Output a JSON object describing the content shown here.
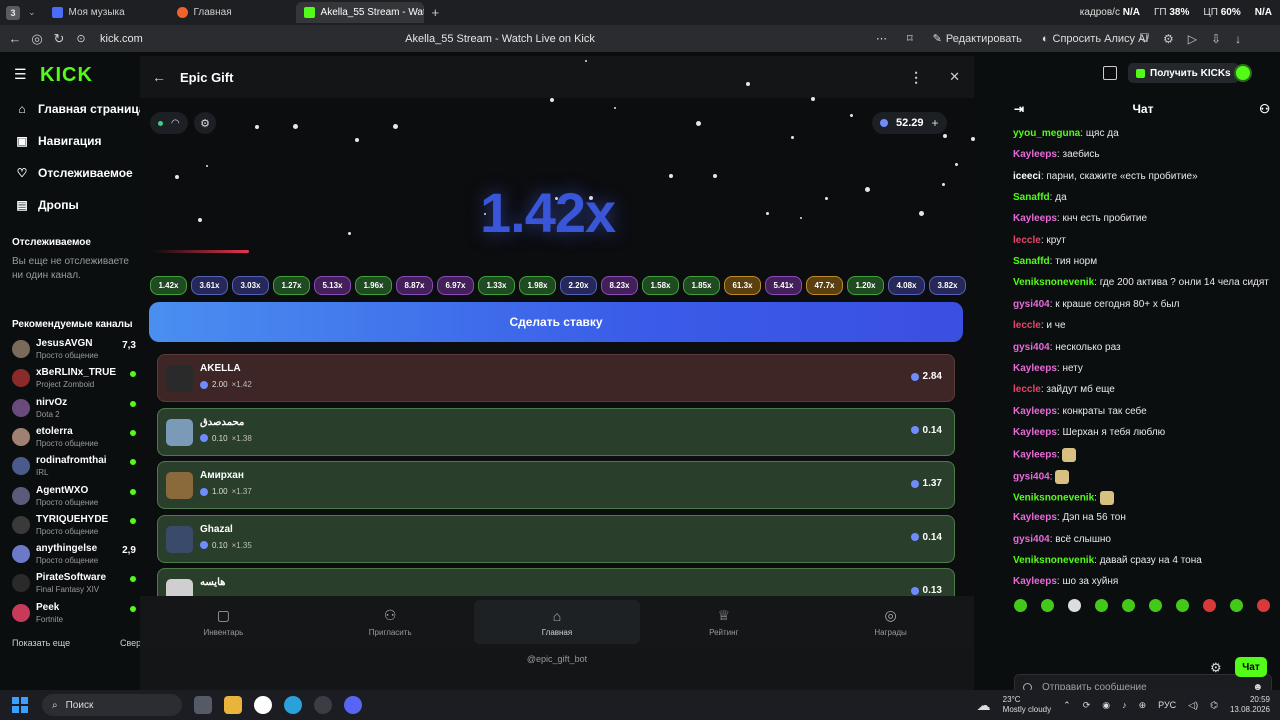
{
  "browser": {
    "tab_count": "3",
    "tabs": [
      {
        "label": "Моя музыка",
        "color": "#4a6cf7"
      },
      {
        "label": "Главная",
        "color": "#f0632a"
      },
      {
        "label": "Akella_55 Stream - Watc",
        "color": "#53fc18"
      }
    ],
    "perf": {
      "fps_label": "кадров/с",
      "fps_value": "N/A",
      "gpu_label": "ГП",
      "gpu_value": "38%",
      "cpu_label": "ЦП",
      "cpu_value": "60%",
      "extra_label": "",
      "extra_value": "N/A"
    },
    "url": "kick.com",
    "page_title": "Akella_55 Stream - Watch Live on Kick",
    "redact_label": "Редактировать",
    "alice_label": "Спросить Алису AI"
  },
  "kick": {
    "logo": "KICK",
    "nav": [
      {
        "label": "Главная страница",
        "icon": "home-icon"
      },
      {
        "label": "Навигация",
        "icon": "compass-icon"
      },
      {
        "label": "Отслеживаемое",
        "icon": "heart-icon"
      },
      {
        "label": "Дропы",
        "icon": "gift-icon"
      }
    ],
    "following_heading": "Отслеживаемое",
    "following_empty": "Вы еще не отслеживаете ни один канал.",
    "recommended_heading": "Рекомендуемые каналы",
    "channels": [
      {
        "name": "JesusAVGN",
        "category": "Просто общение",
        "viewers": "7,3",
        "color": "#7a6a5a"
      },
      {
        "name": "xBeRLINx_TRUE",
        "category": "Project Zomboid",
        "viewers": "",
        "color": "#8a2a2a"
      },
      {
        "name": "nirvOz",
        "category": "Dota 2",
        "viewers": "",
        "color": "#6a4a7a"
      },
      {
        "name": "etolerra",
        "category": "Просто общение",
        "viewers": "",
        "color": "#a08070"
      },
      {
        "name": "rodinafromthai",
        "category": "IRL",
        "viewers": "",
        "color": "#4a5a8a"
      },
      {
        "name": "AgentWXO",
        "category": "Просто общение",
        "viewers": "",
        "color": "#5a5a7a"
      },
      {
        "name": "TYRIQUEHYDE",
        "category": "Просто общение",
        "viewers": "",
        "color": "#3a3a3a"
      },
      {
        "name": "anythingelse",
        "category": "Просто общение",
        "viewers": "2,9",
        "color": "#6a7ac8"
      },
      {
        "name": "PirateSoftware",
        "category": "Final Fantasy XIV",
        "viewers": "",
        "color": "#2a2a2a"
      },
      {
        "name": "Peek",
        "category": "Fortnite",
        "viewers": "",
        "color": "#c83a5a"
      }
    ],
    "show_more": "Показать еще",
    "collapse": "Свер",
    "get_kicks": "Получить KICKs"
  },
  "chat": {
    "title": "Чат",
    "messages": [
      {
        "user": "yyou_meguna",
        "color": "#53fc18",
        "text": "щяс да"
      },
      {
        "user": "Kayleeps",
        "color": "#e86ad8",
        "text": "заебись"
      },
      {
        "user": "iceeci",
        "color": "#ffffff",
        "text": "парни, скажите «есть пробитие»"
      },
      {
        "user": "Sanaffd",
        "color": "#53fc18",
        "text": "да"
      },
      {
        "user": "Kayleeps",
        "color": "#e86ad8",
        "text": "кнч есть пробитие"
      },
      {
        "user": "leccle",
        "color": "#e8456a",
        "text": "крут"
      },
      {
        "user": "Sanaffd",
        "color": "#53fc18",
        "text": "тия норм"
      },
      {
        "user": "Veniksnonevenik",
        "color": "#53fc18",
        "text": "где 200 актива ? онли 14 чела сидят"
      },
      {
        "user": "gysi404",
        "color": "#e86ad8",
        "text": "к краше сегодня 80+ х был"
      },
      {
        "user": "leccle",
        "color": "#e8456a",
        "text": "и че"
      },
      {
        "user": "gysi404",
        "color": "#e86ad8",
        "text": "несколько раз"
      },
      {
        "user": "Kayleeps",
        "color": "#e86ad8",
        "text": "нету"
      },
      {
        "user": "leccle",
        "color": "#e8456a",
        "text": "зайдут мб еще"
      },
      {
        "user": "Kayleeps",
        "color": "#e86ad8",
        "text": "конкраты так себе"
      },
      {
        "user": "Kayleeps",
        "color": "#e86ad8",
        "text": "Шерхан я тебя люблю"
      },
      {
        "user": "Kayleeps",
        "color": "#e86ad8",
        "text": ""
      },
      {
        "user": "gysi404",
        "color": "#e86ad8",
        "text": ""
      },
      {
        "user": "Veniksnonevenik",
        "color": "#53fc18",
        "text": ""
      },
      {
        "user": "Kayleeps",
        "color": "#e86ad8",
        "text": "Дэп на 56 тон"
      },
      {
        "user": "gysi404",
        "color": "#e86ad8",
        "text": "всё слышно"
      },
      {
        "user": "Veniksnonevenik",
        "color": "#53fc18",
        "text": "давай сразу на 4 тона"
      },
      {
        "user": "Kayleeps",
        "color": "#e86ad8",
        "text": "шо за хуйня"
      }
    ],
    "input_placeholder": "Отправить сообщение",
    "send_label": "Чат"
  },
  "app": {
    "title": "Epic Gift",
    "balance": "52.29",
    "multiplier": "1.42x",
    "progress_fraction": 0.12,
    "history": [
      {
        "v": "1.42x",
        "c": "g"
      },
      {
        "v": "3.61x",
        "c": "b"
      },
      {
        "v": "3.03x",
        "c": "b"
      },
      {
        "v": "1.27x",
        "c": "g"
      },
      {
        "v": "5.13x",
        "c": "p"
      },
      {
        "v": "1.96x",
        "c": "g"
      },
      {
        "v": "8.87x",
        "c": "p"
      },
      {
        "v": "6.97x",
        "c": "p"
      },
      {
        "v": "1.33x",
        "c": "g"
      },
      {
        "v": "1.98x",
        "c": "g"
      },
      {
        "v": "2.20x",
        "c": "b"
      },
      {
        "v": "8.23x",
        "c": "p"
      },
      {
        "v": "1.58x",
        "c": "g"
      },
      {
        "v": "1.85x",
        "c": "g"
      },
      {
        "v": "61.3x",
        "c": "o"
      },
      {
        "v": "5.41x",
        "c": "p"
      },
      {
        "v": "47.7x",
        "c": "o"
      },
      {
        "v": "1.20x",
        "c": "g"
      },
      {
        "v": "4.08x",
        "c": "b"
      },
      {
        "v": "3.82x",
        "c": "b"
      }
    ],
    "bet_button": "Сделать ставку",
    "bets": [
      {
        "name": "AKELLA",
        "amount": "2.00",
        "coef": "×1.42",
        "win": "2.84",
        "state": "red",
        "avatar": "#2a2a2a"
      },
      {
        "name": "محمدصدق",
        "amount": "0.10",
        "coef": "×1.38",
        "win": "0.14",
        "state": "green",
        "avatar": "#7a9ab8"
      },
      {
        "name": "Амирхан",
        "amount": "1.00",
        "coef": "×1.37",
        "win": "1.37",
        "state": "green",
        "avatar": "#8a6a3a"
      },
      {
        "name": "Ghazal",
        "amount": "0.10",
        "coef": "×1.35",
        "win": "0.14",
        "state": "green",
        "avatar": "#3a4a6a"
      },
      {
        "name": "هايسه",
        "amount": "",
        "coef": "",
        "win": "0.13",
        "state": "green",
        "avatar": "#cfcfcf"
      }
    ],
    "nav": [
      {
        "label": "Инвентарь",
        "icon": "box-icon",
        "active": false
      },
      {
        "label": "Пригласить",
        "icon": "users-icon",
        "active": false
      },
      {
        "label": "Главная",
        "icon": "home-icon",
        "active": true
      },
      {
        "label": "Рейтинг",
        "icon": "trophy-icon",
        "active": false
      },
      {
        "label": "Награды",
        "icon": "coins-icon",
        "active": false
      }
    ],
    "bot_name": "@epic_gift_bot"
  },
  "taskbar": {
    "search": "Поиск",
    "temp": "23°C",
    "weather": "Mostly cloudy",
    "lang": "РУС",
    "time": "20:59",
    "date": "13.08.2026"
  }
}
